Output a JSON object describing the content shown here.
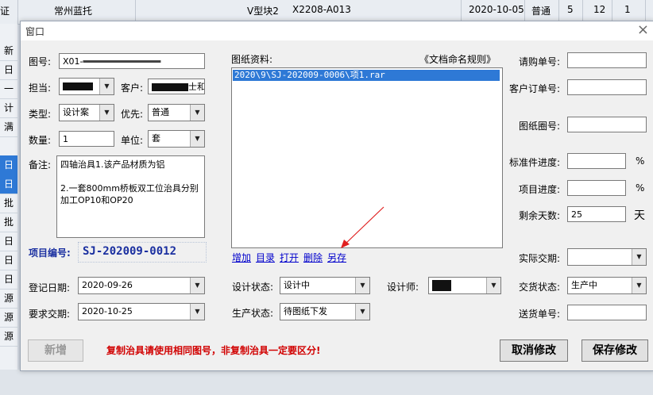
{
  "background_row": {
    "cells": [
      "证",
      "常州蓝托",
      "V型块2",
      "X2208-A013",
      "2020-10-05",
      "普通",
      "5",
      "12",
      "1"
    ]
  },
  "left_strip": [
    "新",
    "日",
    "一",
    "计",
    "满",
    "日",
    "日",
    "批",
    "批",
    "日",
    "日",
    "日",
    "源",
    "源",
    "源"
  ],
  "dialog": {
    "title": "窗口",
    "fields": {
      "drawing_no_label": "图号:",
      "drawing_no_value": "X01-",
      "owner_label": "担当:",
      "customer_label": "客户:",
      "customer_value_tail": "士和",
      "type_label": "类型:",
      "type_value": "设计案",
      "priority_label": "优先:",
      "priority_value": "普通",
      "qty_label": "数量:",
      "qty_value": "1",
      "unit_label": "单位:",
      "unit_value": "套",
      "notes_label": "备注:",
      "notes_value": "四轴治具1.该产品材质为铝\n\n2.一套800mm桥板双工位治具分别加工OP10和OP20",
      "project_no_label": "项目编号:",
      "project_no_value": "SJ-202009-0012",
      "reg_date_label": "登记日期:",
      "reg_date_value": "2020-09-26",
      "req_delivery_label": "要求交期:",
      "req_delivery_value": "2020-10-25"
    },
    "drawing_files": {
      "label": "图纸资料:",
      "naming_rule": "《文档命名规则》",
      "items": [
        "2020\\9\\SJ-202009-0006\\项1.rar"
      ],
      "links": [
        "增加",
        "目录",
        "打开",
        "删除",
        "另存"
      ]
    },
    "design": {
      "design_status_label": "设计状态:",
      "design_status_value": "设计中",
      "designer_label": "设计师:",
      "production_status_label": "生产状态:",
      "production_status_value": "待图纸下发"
    },
    "right": {
      "purchase_no_label": "请购单号:",
      "customer_order_label": "客户订单号:",
      "drawing_circle_label": "图纸圈号:",
      "std_progress_label": "标准件进度:",
      "std_progress_unit": "%",
      "project_progress_label": "项目进度:",
      "project_progress_unit": "%",
      "remaining_days_label": "剩余天数:",
      "remaining_days_value": "25",
      "remaining_days_unit": "天",
      "actual_delivery_label": "实际交期:",
      "delivery_status_label": "交货状态:",
      "delivery_status_value": "生产中",
      "shipping_no_label": "送货单号:"
    },
    "buttons": {
      "new": "新增",
      "cancel": "取消修改",
      "save": "保存修改"
    },
    "warning": "复制治具请使用相同图号，非复制治具一定要区分!"
  },
  "colors": {
    "selection": "#2e79d6",
    "warning": "#d10000",
    "project_no": "#1a2fa0",
    "arrow": "#e02020"
  }
}
